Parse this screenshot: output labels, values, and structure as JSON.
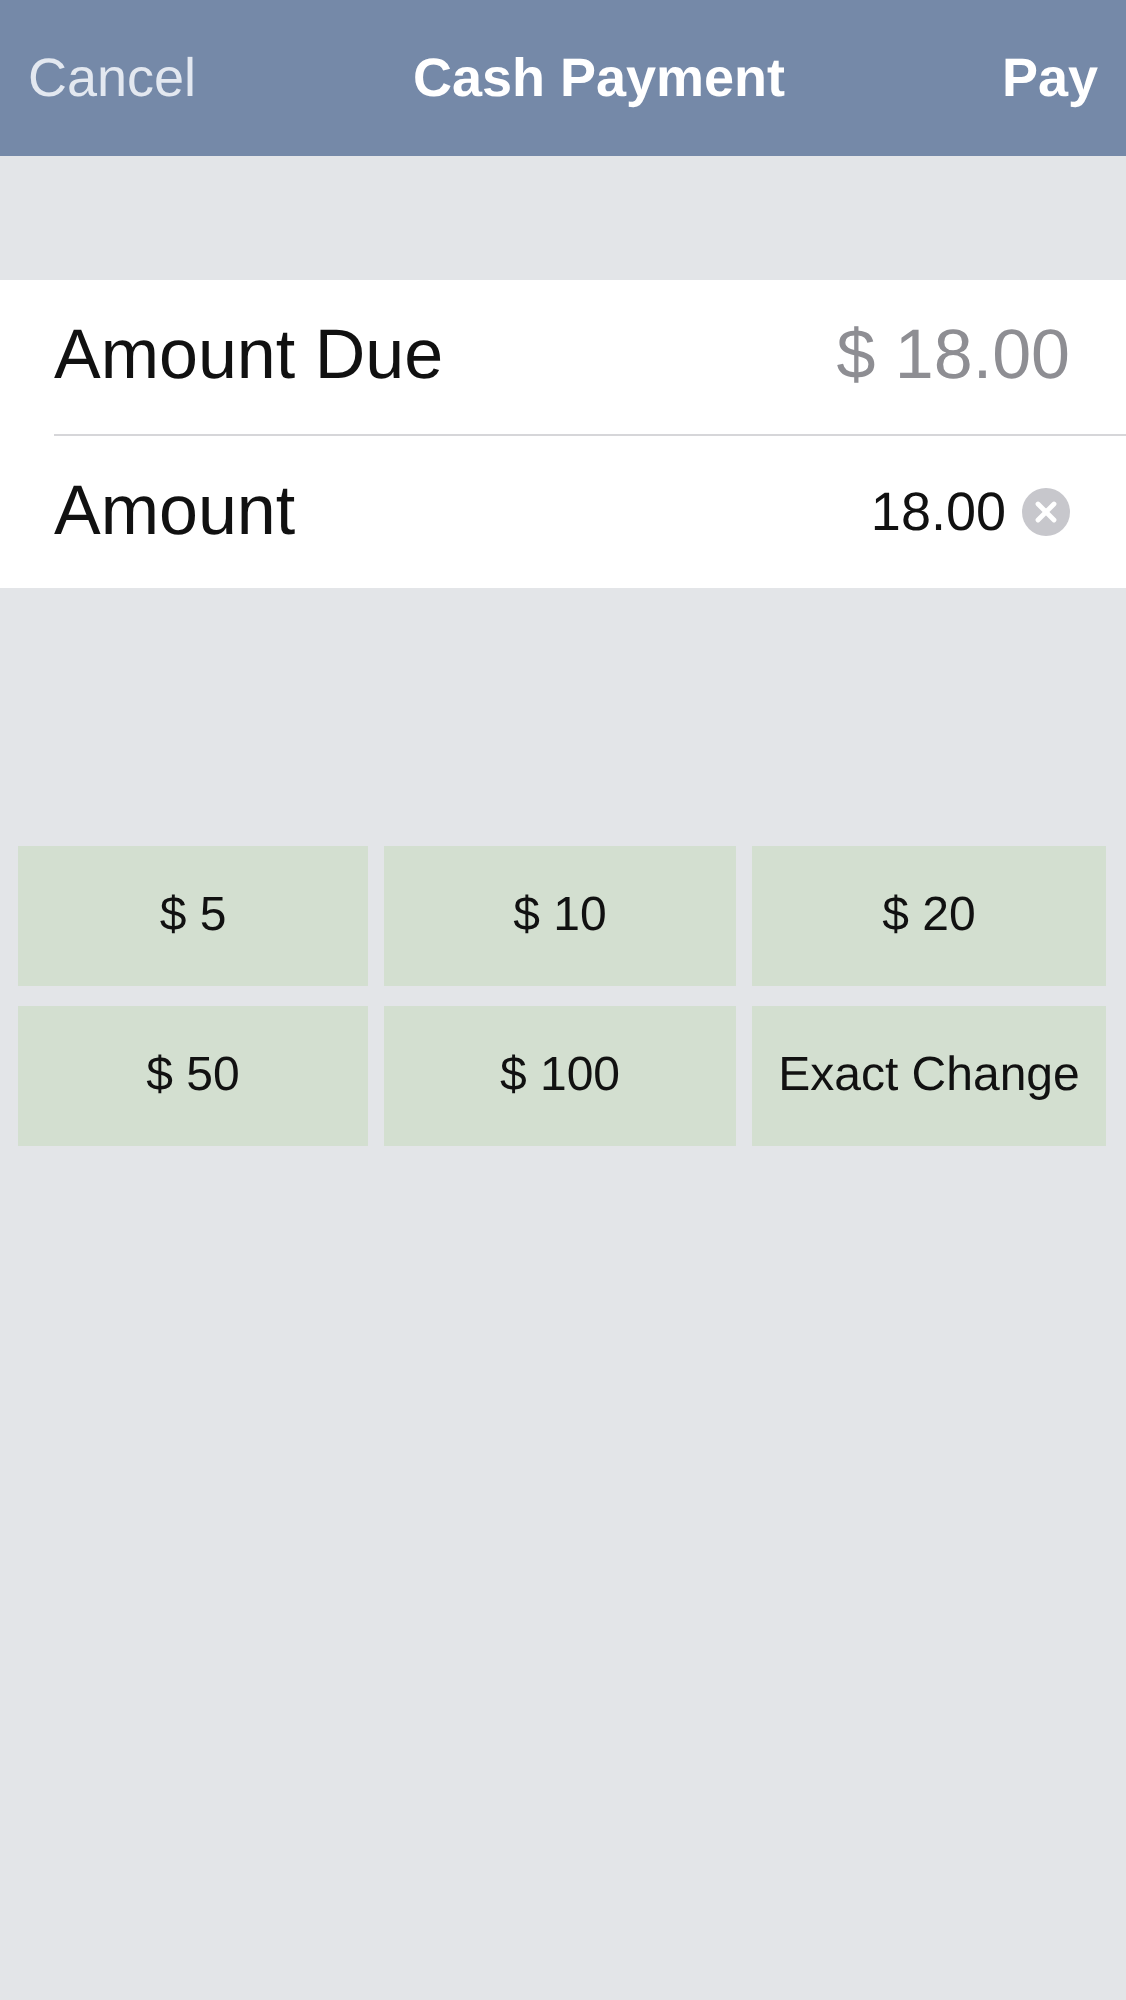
{
  "nav": {
    "cancel": "Cancel",
    "title": "Cash Payment",
    "pay": "Pay"
  },
  "rows": [
    {
      "kind": "display",
      "label": "Amount Due",
      "value": "$ 18.00"
    },
    {
      "kind": "input",
      "label": "Amount",
      "value": "18.00"
    }
  ],
  "quick_buttons": [
    "$ 5",
    "$ 10",
    "$ 20",
    "$ 50",
    "$ 100",
    "Exact Change"
  ]
}
